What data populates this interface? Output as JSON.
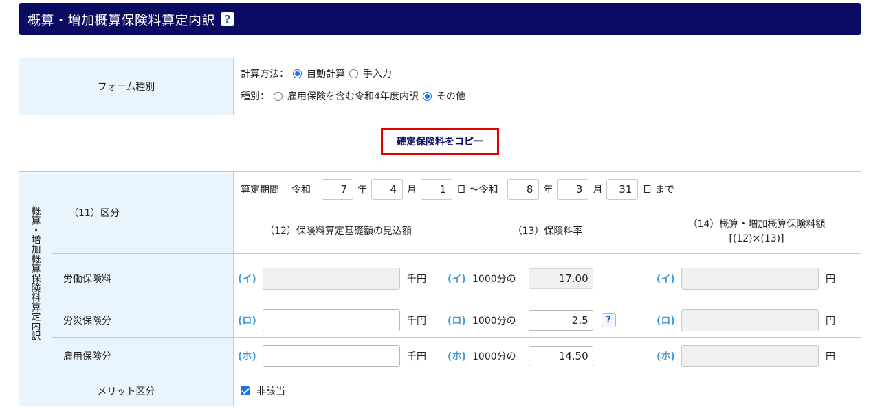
{
  "header": {
    "title": "概算・増加概算保険料算定内訳",
    "help_label": "?"
  },
  "form_type": {
    "label": "フォーム種別",
    "calc_method_label": "計算方法：",
    "calc_auto": "自動計算",
    "calc_manual": "手入力",
    "kind_label": "種別：",
    "kind_option1": "雇用保険を含む令和4年度内訳",
    "kind_option2": "その他"
  },
  "copy_button": "確定保険料をコピー",
  "table": {
    "vertical_label": "概算・増加概算保険料算定内訳",
    "section_label": "（11）区分",
    "period": {
      "label": "算定期間",
      "era1": "令和",
      "y1": "7",
      "y_unit": "年",
      "m1": "4",
      "m_unit": "月",
      "d1": "1",
      "d_unit_tilde": "日 ～令和",
      "y2": "8",
      "m2": "3",
      "d2": "31",
      "end": "日 まで"
    },
    "col12": "（12）保険料算定基礎額の見込額",
    "col13": "（13）保険料率",
    "col14_line1": "（14）概算・増加概算保険料額",
    "col14_line2": "[(12)×(13)]",
    "per_mille": "1000分の",
    "unit_thousand": "千円",
    "unit_yen": "円",
    "rows": [
      {
        "label": "労働保険料",
        "kana": "(イ)",
        "rate": "17.00"
      },
      {
        "label": "労災保険分",
        "kana": "(ロ)",
        "rate": "2.5"
      },
      {
        "label": "雇用保険分",
        "kana": "(ホ)",
        "rate": "14.50"
      }
    ],
    "help_small": "?",
    "merit_label": "メリット区分",
    "merit_check": "非該当"
  }
}
